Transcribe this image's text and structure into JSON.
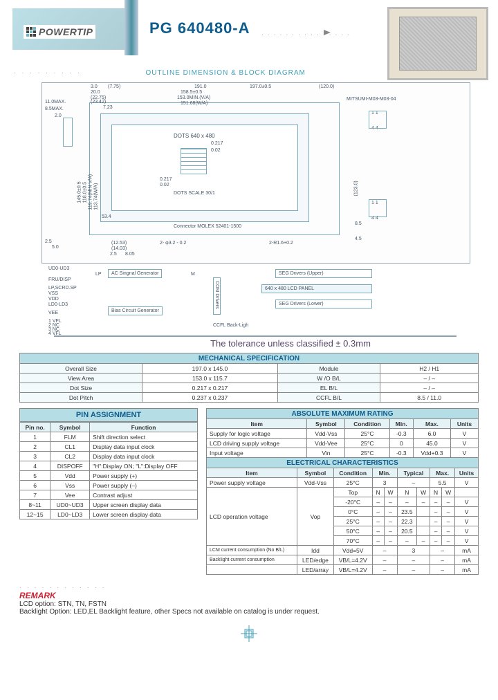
{
  "brand": "POWERTIP",
  "model": "PG 640480-A",
  "section1": "OUTLINE  DIMENSION & BLOCK DIAGRAM",
  "diagram": {
    "dims_top": [
      "3.0",
      "(7.75)",
      "20.0",
      "(22.75)",
      "(23.42)",
      "7.23",
      "191.0",
      "158.5±0.5",
      "153.0MIN.(V/A)",
      "151.68(W/A)",
      "197.0±0.5",
      "(120.0)"
    ],
    "left": [
      "11.0MAX.",
      "8.5MAX.",
      "2.0",
      "145.0±0.5",
      "118.0±0.5",
      "119.74(MIN V/A)",
      "113.74(W/A)",
      "53.4",
      "2.5",
      "5.0"
    ],
    "right": [
      "MITSUMI-M03-M03-04",
      "(123.0)",
      "8.5",
      "4.5",
      "1   1",
      "4   4",
      "1   1",
      "4   4"
    ],
    "inner": [
      "DOTS 640 x 480",
      "0.217",
      "0.02",
      "0.217",
      "0.02",
      "DOTS SCALE 30/1",
      "Connector MOLEX 52401-1500",
      "2- φ3.2 - 0.2",
      "2-R1.6+0.2",
      "(12.53)",
      "(14.03)",
      "8.05",
      "2.5"
    ]
  },
  "block": {
    "left_labels": [
      "UD0-UD3",
      "FRU/DISP",
      "LP,SCRD.SP",
      "VSS",
      "VDD",
      "LD0-LD3",
      "VEE",
      "1 VFL",
      "2 NC",
      "3 NC",
      "4 VFL"
    ],
    "boxes": [
      "AC Singnal Generator",
      "COM Drivers",
      "Bias Circuit Generator",
      "SEG  Drivers (Upper)",
      "640 x 480 LCD PANEL",
      "SEG  Drivers (Lower)",
      "CCFL Back-Ligh"
    ],
    "wires": [
      "LP",
      "M"
    ]
  },
  "tolerance": "The  tolerance  unless  classified ± 0.3mm",
  "mech": {
    "title": "MECHANICAL  SPECIFICATION",
    "rows": [
      [
        "Overall Size",
        "197.0 x 145.0",
        "Module",
        "H2 / H1"
      ],
      [
        "View Area",
        "153.0 x 115.7",
        "W /O  B/L",
        "–  /  –"
      ],
      [
        "Dot Size",
        "0.217 x 0.217",
        "EL B/L",
        "–  /  –"
      ],
      [
        "Dot Pitch",
        "0.237 x 0.237",
        "CCFL B/L",
        "8.5 / 11.0"
      ]
    ]
  },
  "pin": {
    "title": "PIN ASSIGNMENT",
    "head": [
      "Pin no.",
      "Symbol",
      "Function"
    ],
    "rows": [
      [
        "1",
        "FLM",
        "Shift direction select"
      ],
      [
        "2",
        "CL1",
        "Display data input clock"
      ],
      [
        "3",
        "CL2",
        "Display data input clock"
      ],
      [
        "4",
        "DISPOFF",
        "\"H\":Display ON; \"L\":Display OFF"
      ],
      [
        "5",
        "Vdd",
        "Power supply (+)"
      ],
      [
        "6",
        "Vss",
        "Power supply (–)"
      ],
      [
        "7",
        "Vee",
        "Contrast adjust"
      ],
      [
        "8~11",
        "UD0~UD3",
        "Upper screen display data"
      ],
      [
        "12~15",
        "LD0~LD3",
        "Lower screen display data"
      ]
    ]
  },
  "abs": {
    "title": "ABSOLUTE MAXIMUM RATING",
    "head": [
      "Item",
      "Symbol",
      "Condition",
      "Min.",
      "Max.",
      "Units"
    ],
    "rows": [
      [
        "Supply for logic voltage",
        "Vdd-Vss",
        "25°C",
        "-0.3",
        "6.0",
        "V"
      ],
      [
        "LCD driving supply voltage",
        "Vdd-Vee",
        "25°C",
        "0",
        "45.0",
        "V"
      ],
      [
        "Input voltage",
        "Vin",
        "25°C",
        "-0.3",
        "Vdd+0.3",
        "V"
      ]
    ]
  },
  "elec": {
    "title": "ELECTRICAL CHARACTERISTICS",
    "head": [
      "Item",
      "Symbol",
      "Condition",
      "Min.",
      "Typical",
      "Max.",
      "Units"
    ],
    "rows_psv": [
      "Power supply voltage",
      "Vdd-Vss",
      "25°C",
      "3",
      "–",
      "5.5",
      "V"
    ],
    "rows_top": [
      "",
      "",
      "Top",
      "N",
      "W",
      "N",
      "W",
      "N",
      "W",
      ""
    ],
    "vop": [
      [
        "-20°C",
        "–",
        "–",
        "–",
        "–",
        "–",
        "–",
        "V"
      ],
      [
        "0°C",
        "–",
        "–",
        "23.5",
        "",
        "–",
        "–",
        "V"
      ],
      [
        "25°C",
        "–",
        "–",
        "22.3",
        "",
        "–",
        "–",
        "V"
      ],
      [
        "50°C",
        "–",
        "–",
        "20.5",
        "",
        "–",
        "–",
        "V"
      ],
      [
        "70°C",
        "–",
        "–",
        "–",
        "–",
        "–",
        "–",
        "V"
      ]
    ],
    "vop_label": "LCD operation voltage",
    "vop_sym": "Vop",
    "rows_foot": [
      [
        "LCM current consumption (No B/L)",
        "Idd",
        "Vdd=5V",
        "–",
        "3",
        "–",
        "mA"
      ],
      [
        "Backlight current consumption",
        "LED/edge",
        "VB/L=4.2V",
        "–",
        "–",
        "–",
        "mA"
      ],
      [
        "",
        "LED/array",
        "VB/L=4.2V",
        "–",
        "–",
        "–",
        "mA"
      ]
    ]
  },
  "remark": {
    "title": "REMARK",
    "line1": "LCD option: STN, TN, FSTN",
    "line2": "Backlight Option:  LED,EL Backlight feature, other Specs not available on catalog is under request."
  }
}
